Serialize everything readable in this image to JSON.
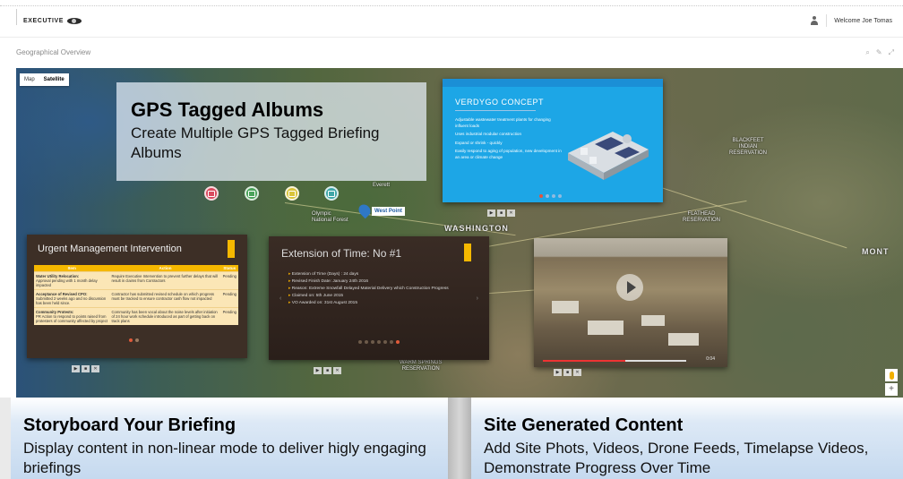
{
  "header": {
    "logo_text": "EXECUTIVE",
    "welcome": "Welcome Joe Tomas"
  },
  "panel": {
    "title": "Geographical Overview",
    "tools": [
      "⌕",
      "✎",
      "⤢"
    ]
  },
  "map": {
    "map_types": [
      "Map",
      "Satellite"
    ],
    "labels": {
      "washington": "WASHINGTON",
      "mont": "MONT",
      "blackfeet": "BLACKFEET\nINDIAN\nRESERVATION",
      "warm_springs": "WARM SPRINGS\nRESERVATION",
      "flathead": "FLATHEAD\nRESERVATION",
      "everett": "Everett",
      "olympic": "Olympic\nNational Forest"
    },
    "marker_label": "West Point"
  },
  "promo_gps": {
    "title": "GPS Tagged Albums",
    "subtitle": "Create Multiple GPS Tagged Briefing Albums"
  },
  "verdygo": {
    "title": "VERDYGO CONCEPT",
    "bullets": [
      "Adjustable wastewater treatment plants for changing influent loads",
      "Uses industrial modular construction",
      "Expand or shrink - quickly",
      "Easily respond to aging of population, new development in an area or climate change"
    ]
  },
  "urgent": {
    "title": "Urgent Management Intervention",
    "headers": [
      "Item",
      "Action",
      "Status"
    ],
    "rows": [
      {
        "item": "Water Utility Relocation:",
        "item_detail": "Approval pending with 1 month delay impacted",
        "action": "Require Executive Intervention to prevent further delays that will result in claims from Contractors",
        "status": "Pending"
      },
      {
        "item": "Acceptance of Revised CPO:",
        "item_detail": "Submitted 2 weeks ago and no discussion has been held since.",
        "action": "Contractor has submitted revised schedule on which progress must be tracked to ensure contractor cash flow not impacted",
        "status": "Pending"
      },
      {
        "item": "Community Protests:",
        "item_detail": "PR Action to respond to points raised from protesters of community affected by project",
        "action": "Community has been vocal about the noise levels after initiation of 24 hour work schedule introduced as part of getting back on track plans",
        "status": "Pending"
      }
    ]
  },
  "eot": {
    "title": "Extension of Time: No #1",
    "bullets": [
      "Extension of Time (Days) : 24 days",
      "Revised Finish Date: January 24th 2016",
      "Reason: Extreme Snowfall Delayed Material Delivery which Construction Progress",
      "Claimed on: 5th June 2015",
      "VO Awarded on: 31st August 2015"
    ]
  },
  "video": {
    "time": "0:04"
  },
  "promo_storyboard": {
    "title": "Storyboard Your Briefing",
    "subtitle": "Display content in non-linear mode to deliver higly engaging briefings"
  },
  "promo_site": {
    "title": "Site Generated Content",
    "subtitle": "Add Site Phots, Videos, Drone Feeds, Timelapse Videos, Demonstrate Progress Over Time"
  },
  "colors": {
    "accent_blue": "#1b8fd6",
    "accent_yellow": "#f5b800",
    "accent_red": "#e05a3a"
  }
}
